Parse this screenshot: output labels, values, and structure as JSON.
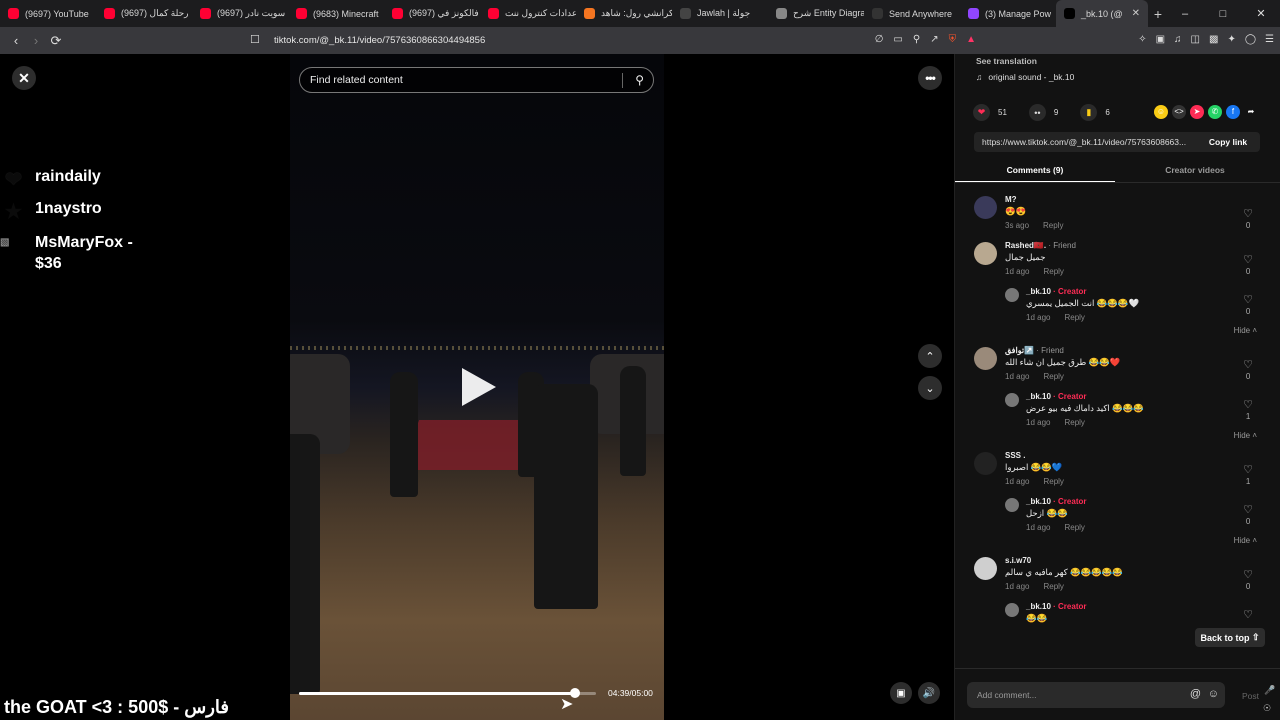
{
  "browser": {
    "tabs": [
      {
        "label": "(9697) YouTube",
        "favicon_color": "#ff0033"
      },
      {
        "label": "(9697) رحلة كمال",
        "favicon_color": "#ff0033"
      },
      {
        "label": "(9697) سويت نادر",
        "favicon_color": "#ff0033"
      },
      {
        "label": "(9683) Minecraft",
        "favicon_color": "#ff0033"
      },
      {
        "label": "(9697) فالكونز في",
        "favicon_color": "#ff0033"
      },
      {
        "label": "اعدادات كنترول ننت",
        "favicon_color": "#ff0033"
      },
      {
        "label": "كرانشي رول: شاهد",
        "favicon_color": "#f47521"
      },
      {
        "label": "Jawlah | جولة",
        "favicon_color": "#444444"
      },
      {
        "label": "شرح Entity Diagram",
        "favicon_color": "#888888"
      },
      {
        "label": "Send Anywhere",
        "favicon_color": "#333333"
      },
      {
        "label": "(3) Manage Pow",
        "favicon_color": "#9146ff"
      },
      {
        "label": "_bk.10 (@",
        "favicon_color": "#000000",
        "active": true
      }
    ],
    "url": "tiktok.com/@_bk.11/video/7576360866304494856"
  },
  "overlay": {
    "gifters": [
      {
        "name": "raindaily",
        "icon": "heart-icon"
      },
      {
        "name": "1naystro",
        "icon": "star-icon"
      },
      {
        "name": "MsMaryFox - $36",
        "icon": "broken-image-icon"
      }
    ],
    "banner": "the GOAT <3 : 500$ - فارس"
  },
  "video": {
    "search_placeholder": "Find related content",
    "current_time": "04:39",
    "duration": "05:00",
    "time_label": "04:39/05:00",
    "progress_fraction": 0.93
  },
  "panel": {
    "see_translation": "See translation",
    "sound": "original sound - _bk.10",
    "likes": "51",
    "comments_count": "9",
    "saves": "6",
    "link": "https://www.tiktok.com/@_bk.11/video/75763608663...",
    "copy_link": "Copy link",
    "tab_comments": "Comments (9)",
    "tab_creator": "Creator videos",
    "back_to_top": "Back to top",
    "add_comment": "Add comment...",
    "post": "Post",
    "hide": "Hide",
    "reply": "Reply",
    "comments": [
      {
        "name": "M?",
        "tag": "",
        "text": "😍😍",
        "time": "3s ago",
        "likes": "0",
        "reply": false,
        "avatar": "#3a3a5a"
      },
      {
        "name": "Rashed🇲🇦.",
        "tag": "· Friend",
        "text": "جميل جمال",
        "time": "1d ago",
        "likes": "0",
        "reply": false,
        "avatar": "#b8a890"
      },
      {
        "name": "_bk.10",
        "tag": "· Creator",
        "text": "انت الجميل يمسري 😂😂😂🤍",
        "time": "1d ago",
        "likes": "0",
        "reply": true,
        "avatar": "#777777",
        "hide_after": true
      },
      {
        "name": "توافق↗️",
        "tag": "· Friend",
        "text": "طرق جميل ان شاء الله 😂😂❤️",
        "time": "1d ago",
        "likes": "0",
        "reply": false,
        "avatar": "#9a8a7a"
      },
      {
        "name": "_bk.10",
        "tag": "· Creator",
        "text": "اكيد داماك فيه بيو عرض 😂😂😂",
        "time": "1d ago",
        "likes": "1",
        "reply": true,
        "avatar": "#777777",
        "hide_after": true
      },
      {
        "name": "SSS .",
        "tag": "",
        "text": "اصبروا 😂😂💙",
        "time": "1d ago",
        "likes": "1",
        "reply": false,
        "avatar": "#222222"
      },
      {
        "name": "_bk.10",
        "tag": "· Creator",
        "text": "ازحل 😂😂",
        "time": "1d ago",
        "likes": "0",
        "reply": true,
        "avatar": "#777777",
        "hide_after": true
      },
      {
        "name": "s.i.w70",
        "tag": "",
        "text": "كهر مافيه ي سالم 😂😂😂😂😂",
        "time": "1d ago",
        "likes": "0",
        "reply": false,
        "avatar": "#cfcfcf"
      },
      {
        "name": "_bk.10",
        "tag": "· Creator",
        "text": "😂😂",
        "time": "",
        "likes": "",
        "reply": true,
        "avatar": "#777777"
      }
    ]
  }
}
